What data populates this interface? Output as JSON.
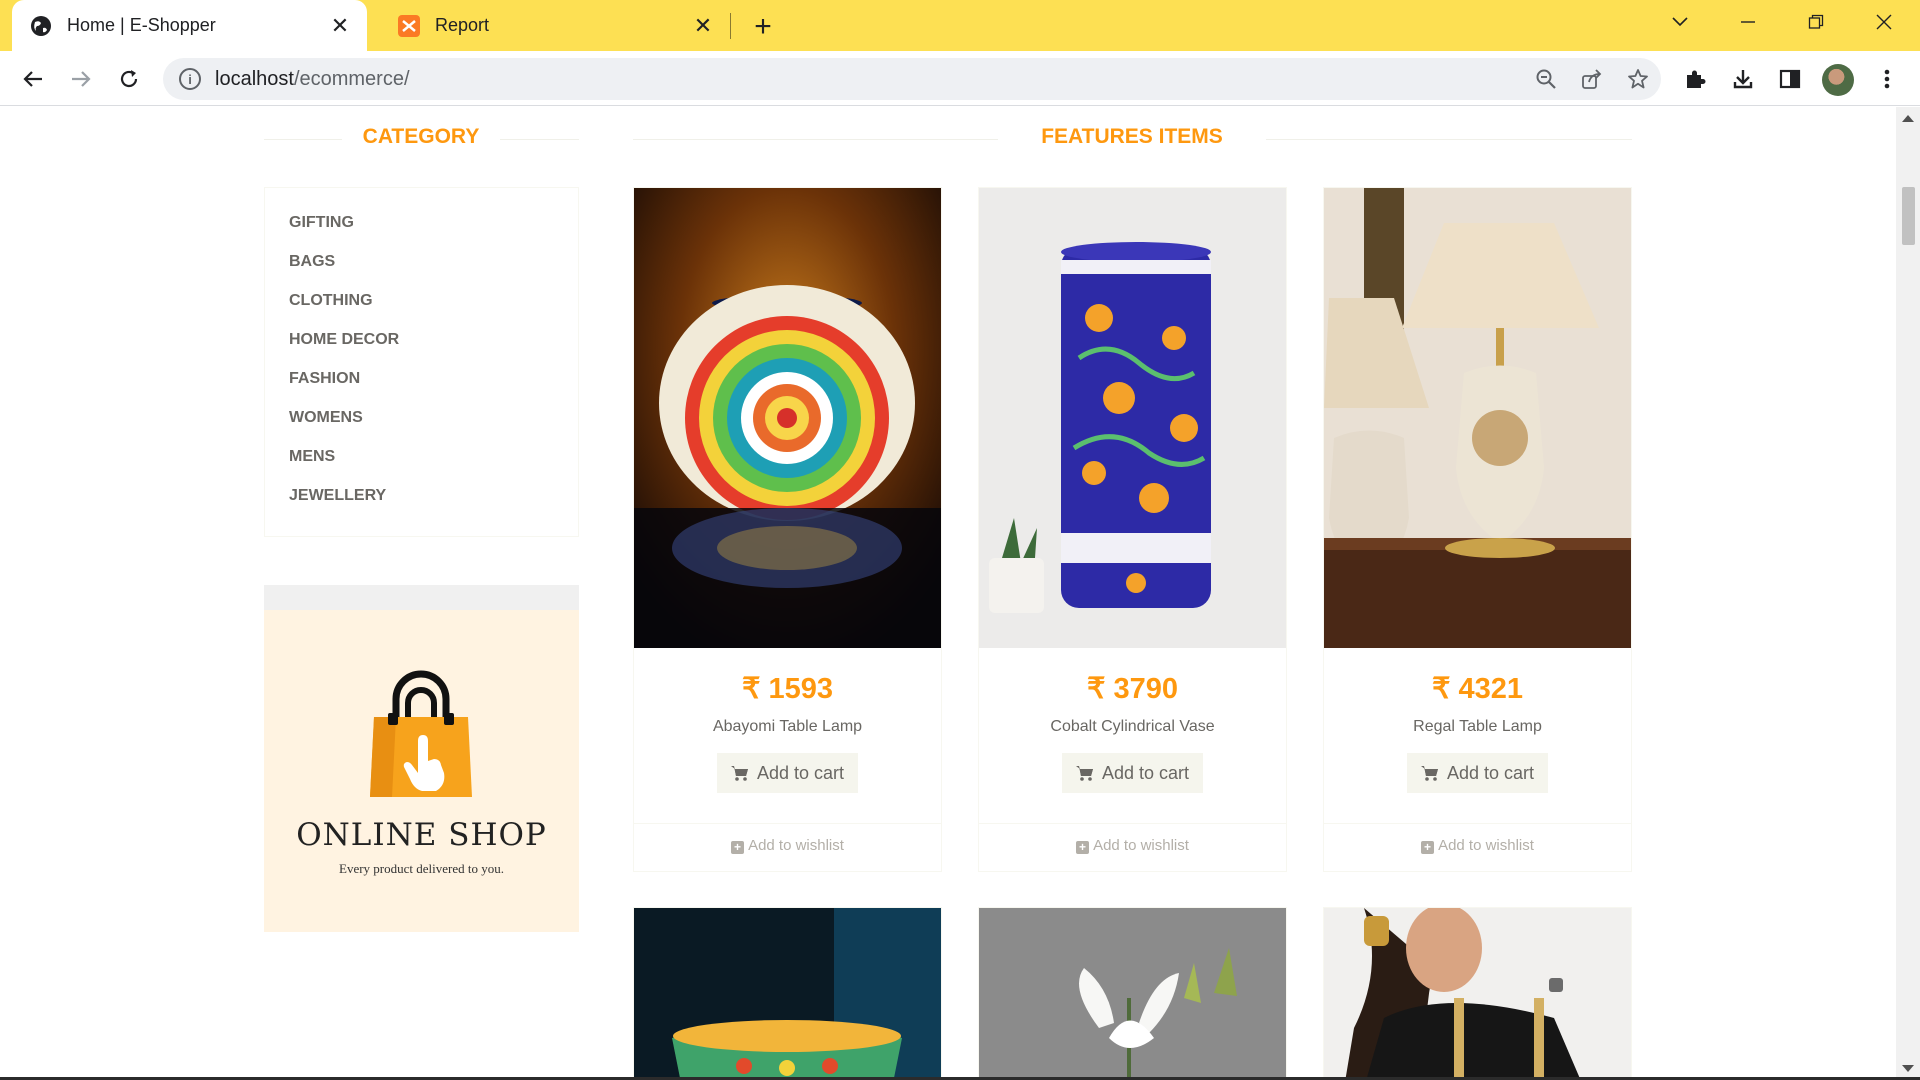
{
  "browser": {
    "tabs": [
      {
        "title": "Home | E-Shopper",
        "favicon": "globe-icon",
        "active": true
      },
      {
        "title": "Report",
        "favicon": "xampp-icon",
        "active": false
      }
    ],
    "url_host": "localhost",
    "url_path": "/ecommerce/"
  },
  "page": {
    "category_heading": "CATEGORY",
    "features_heading": "FEATURES ITEMS",
    "categories": [
      "GIFTING",
      "BAGS",
      "CLOTHING",
      "HOME DECOR",
      "FASHION",
      "WOMENS",
      "MENS",
      "JEWELLERY"
    ],
    "promo": {
      "title": "ONLINE SHOP",
      "subtitle": "Every product delivered to you."
    },
    "products": [
      {
        "price": "₹ 1593",
        "name": "Abayomi Table Lamp",
        "cart_label": "Add to cart",
        "wishlist_label": "Add to wishlist"
      },
      {
        "price": "₹ 3790",
        "name": "Cobalt Cylindrical Vase",
        "cart_label": "Add to cart",
        "wishlist_label": "Add to wishlist"
      },
      {
        "price": "₹ 4321",
        "name": "Regal Table Lamp",
        "cart_label": "Add to cart",
        "wishlist_label": "Add to wishlist"
      }
    ],
    "colors": {
      "accent": "#fe980f",
      "tabbar": "#fde053",
      "category_text": "#696763",
      "promo_bg": "#fff3e1"
    }
  }
}
